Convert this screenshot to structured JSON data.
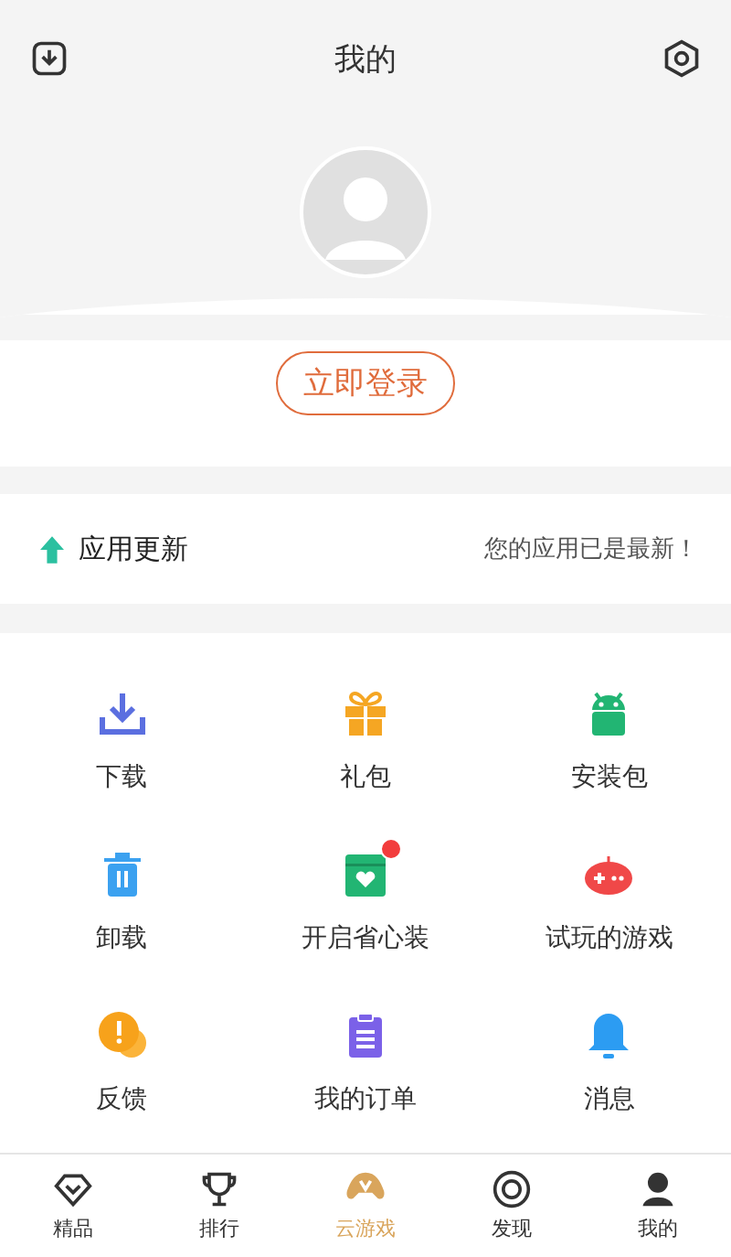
{
  "header": {
    "title": "我的"
  },
  "login": {
    "label": "立即登录"
  },
  "update": {
    "label": "应用更新",
    "status": "您的应用已是最新！"
  },
  "tools": [
    {
      "kind": "download",
      "label": "下载",
      "badge": false
    },
    {
      "kind": "gift",
      "label": "礼包",
      "badge": false
    },
    {
      "kind": "android",
      "label": "安装包",
      "badge": false
    },
    {
      "kind": "trash",
      "label": "卸载",
      "badge": false
    },
    {
      "kind": "heartbox",
      "label": "开启省心装",
      "badge": true
    },
    {
      "kind": "gamepad",
      "label": "试玩的游戏",
      "badge": false
    },
    {
      "kind": "feedback",
      "label": "反馈",
      "badge": false
    },
    {
      "kind": "order",
      "label": "我的订单",
      "badge": false
    },
    {
      "kind": "bell",
      "label": "消息",
      "badge": false
    }
  ],
  "tabs": [
    {
      "kind": "diamond",
      "label": "精品",
      "selected": false
    },
    {
      "kind": "trophy",
      "label": "排行",
      "selected": false
    },
    {
      "kind": "cloud",
      "label": "云游戏",
      "selected": true
    },
    {
      "kind": "discover",
      "label": "发现",
      "selected": false
    },
    {
      "kind": "person",
      "label": "我的",
      "selected": false
    }
  ]
}
